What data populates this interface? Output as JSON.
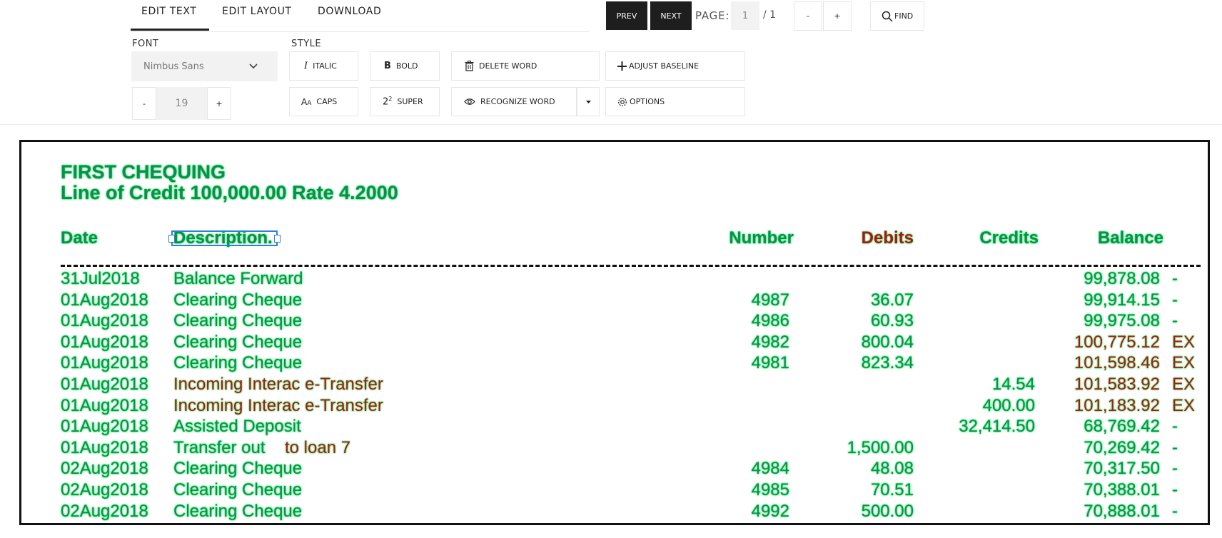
{
  "tabs": [
    {
      "label": "EDIT TEXT",
      "active": true
    },
    {
      "label": "EDIT LAYOUT",
      "active": false
    },
    {
      "label": "DOWNLOAD",
      "active": false
    }
  ],
  "pager": {
    "prev_label": "PREV",
    "next_label": "NEXT",
    "page_label": "PAGE:",
    "page_value": "1",
    "page_total": "/ 1",
    "zoom_out_label": "-",
    "zoom_in_label": "+",
    "find_label": "FIND"
  },
  "font": {
    "section_label": "FONT",
    "family": "Nimbus Sans",
    "size": "19",
    "size_minus": "-",
    "size_plus": "+"
  },
  "style": {
    "section_label": "STYLE",
    "italic_label": "ITALIC",
    "bold_label": "BOLD",
    "delete_word_label": "DELETE WORD",
    "adjust_baseline_label": "ADJUST BASELINE",
    "caps_label": "CAPS",
    "super_label": "SUPER",
    "recognize_word_label": "RECOGNIZE WORD",
    "options_label": "OPTIONS"
  },
  "document": {
    "title": "FIRST CHEQUING",
    "subtitle": "Line of Credit 100,000.00 Rate 4.2000",
    "headers": {
      "date": "Date",
      "description": "Description.",
      "number": "Number",
      "debits": "Debits",
      "credits": "Credits",
      "balance": "Balance"
    },
    "rows": [
      {
        "date": "31Jul2018",
        "desc": "Balance Forward",
        "desc2": "",
        "number": "",
        "debit": "",
        "credit": "",
        "balance": "99,878.08",
        "flag": "-"
      },
      {
        "date": "01Aug2018",
        "desc": "Clearing Cheque",
        "desc2": "",
        "number": "4987",
        "debit": "36.07",
        "credit": "",
        "balance": "99,914.15",
        "flag": "-"
      },
      {
        "date": "01Aug2018",
        "desc": "Clearing Cheque",
        "desc2": "",
        "number": "4986",
        "debit": "60.93",
        "credit": "",
        "balance": "99,975.08",
        "flag": "-"
      },
      {
        "date": "01Aug2018",
        "desc": "Clearing Cheque",
        "desc2": "",
        "number": "4982",
        "debit": "800.04",
        "credit": "",
        "balance": "100,775.12",
        "flag": "EX"
      },
      {
        "date": "01Aug2018",
        "desc": "Clearing Cheque",
        "desc2": "",
        "number": "4981",
        "debit": "823.34",
        "credit": "",
        "balance": "101,598.46",
        "flag": "EX"
      },
      {
        "date": "01Aug2018",
        "desc": "Incoming Interac e-Transfer",
        "desc2": "",
        "number": "",
        "debit": "",
        "credit": "14.54",
        "balance": "101,583.92",
        "flag": "EX"
      },
      {
        "date": "01Aug2018",
        "desc": "Incoming Interac e-Transfer",
        "desc2": "",
        "number": "",
        "debit": "",
        "credit": "400.00",
        "balance": "101,183.92",
        "flag": "EX"
      },
      {
        "date": "01Aug2018",
        "desc": "Assisted Deposit",
        "desc2": "",
        "number": "",
        "debit": "",
        "credit": "32,414.50",
        "balance": "68,769.42",
        "flag": "-"
      },
      {
        "date": "01Aug2018",
        "desc": "Transfer out",
        "desc2": "to loan 7",
        "number": "",
        "debit": "1,500.00",
        "credit": "",
        "balance": "70,269.42",
        "flag": "-"
      },
      {
        "date": "02Aug2018",
        "desc": "Clearing Cheque",
        "desc2": "",
        "number": "4984",
        "debit": "48.08",
        "credit": "",
        "balance": "70,317.50",
        "flag": "-"
      },
      {
        "date": "02Aug2018",
        "desc": "Clearing Cheque",
        "desc2": "",
        "number": "4985",
        "debit": "70.51",
        "credit": "",
        "balance": "70,388.01",
        "flag": "-"
      },
      {
        "date": "02Aug2018",
        "desc": "Clearing Cheque",
        "desc2": "",
        "number": "4992",
        "debit": "500.00",
        "credit": "",
        "balance": "70,888.01",
        "flag": "-"
      }
    ]
  },
  "colors": {
    "ocr_text": "#0a8f50",
    "ocr_glow": "#3be86a",
    "flagged_text": "#b01515",
    "selection": "#2e7fd6"
  }
}
